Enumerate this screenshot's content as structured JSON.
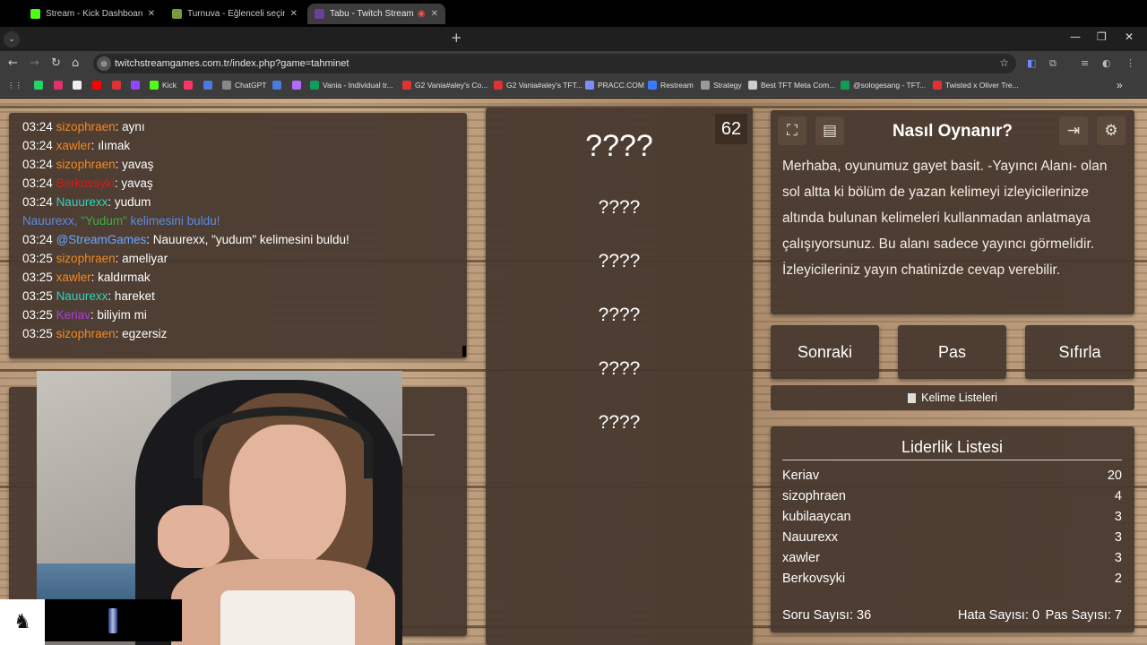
{
  "browser": {
    "tabs": [
      {
        "title": "Stream - Kick Dashboard",
        "close": "✕",
        "favicon_color": "#53fc18"
      },
      {
        "title": "Turnuva - Eğlenceli seçimler yap",
        "close": "✕",
        "favicon_color": "#7a9a3a"
      },
      {
        "title": "Tabu - Twitch Stream Games",
        "close": "✕",
        "favicon_color": "#6b3fa0",
        "recording": "◉"
      }
    ],
    "new_tab": "+",
    "url": "twitchstreamgames.com.tr/index.php?game=tahminet",
    "window_controls": {
      "minimize": "—",
      "maximize": "❐",
      "close": "✕"
    },
    "nav": {
      "back": "←",
      "forward": "→",
      "reload": "↻",
      "home": "⌂",
      "site_info": "⊜",
      "star": "☆",
      "menu": "⋮"
    },
    "bookmarks": [
      {
        "label": "",
        "color": "#25d366"
      },
      {
        "label": "",
        "color": "#e1306c"
      },
      {
        "label": "",
        "color": "#222222"
      },
      {
        "label": "",
        "color": "#ff0000"
      },
      {
        "label": "",
        "color": "#d33"
      },
      {
        "label": "",
        "color": "#9146ff"
      },
      {
        "label": "Kick",
        "color": "#53fc18"
      },
      {
        "label": "",
        "color": "#ff3366"
      },
      {
        "label": "",
        "color": "#4a7adf"
      },
      {
        "label": "ChatGPT",
        "color": "#888888"
      },
      {
        "label": "",
        "color": "#4a7adf"
      },
      {
        "label": "",
        "color": "#b36bff"
      },
      {
        "label": "Vania - Individual tr...",
        "color": "#0f9d58"
      },
      {
        "label": "G2 Vania#aley's Co...",
        "color": "#d33"
      },
      {
        "label": "G2 Vania#aley's TFT...",
        "color": "#d33"
      },
      {
        "label": "PRACC.COM",
        "color": "#7b8cff"
      },
      {
        "label": "Restream",
        "color": "#3b7bff"
      },
      {
        "label": "Strategy",
        "color": "#999999"
      },
      {
        "label": "Best TFT Meta Com...",
        "color": "#cccccc"
      },
      {
        "label": "@sologesang - TFT...",
        "color": "#0f9d58"
      },
      {
        "label": "Twisted x Oliver Tre...",
        "color": "#d33"
      }
    ],
    "bookmarks_more": "»"
  },
  "chat": {
    "messages": [
      {
        "time": "03:24",
        "user": "sizophraen",
        "color": "#f08a24",
        "text": ": aynı"
      },
      {
        "time": "03:24",
        "user": "xawler",
        "color": "#f08a24",
        "text": ": ılımak"
      },
      {
        "time": "03:24",
        "user": "sizophraen",
        "color": "#f08a24",
        "text": ": yavaş"
      },
      {
        "time": "03:24",
        "user": "Berkovsyki",
        "color": "#d41c1c",
        "text": ": yavaş"
      },
      {
        "time": "03:24",
        "user": "Nauurexx",
        "color": "#2fd3c0",
        "text": ": yudum"
      },
      {
        "time": "03:24",
        "user": "@StreamGames",
        "color": "#69a8ff",
        "text": ": Nauurexx, \"yudum\" kelimesini buldu!"
      },
      {
        "time": "03:25",
        "user": "sizophraen",
        "color": "#f08a24",
        "text": ": ameliyar"
      },
      {
        "time": "03:25",
        "user": "xawler",
        "color": "#f08a24",
        "text": ": kaldırmak"
      },
      {
        "time": "03:25",
        "user": "Nauurexx",
        "color": "#2fd3c0",
        "text": ": hareket"
      },
      {
        "time": "03:25",
        "user": "Keriav",
        "color": "#b03ae0",
        "text": ": biliyim mi"
      },
      {
        "time": "03:25",
        "user": "sizophraen",
        "color": "#f08a24",
        "text": ": egzersiz"
      }
    ],
    "system_notice": {
      "prefix": "Nauurexx, ",
      "word": "\"Yudum\"",
      "suffix": " kelimesini buldu!"
    }
  },
  "game": {
    "timer": "62",
    "main_word": "????",
    "forbidden_words": [
      "????",
      "????",
      "????",
      "????",
      "????"
    ]
  },
  "howto": {
    "title": "Nasıl Oynanır?",
    "text": "Merhaba, oyunumuz gayet basit. -Yayıncı Alanı- olan sol altta ki bölüm de yazan kelimeyi izleyicilerinize altında bulunan kelimeleri kullanmadan anlatmaya çalışıyorsunuz. Bu alanı sadece yayıncı görmelidir. İzleyicileriniz yayın chatinizde cevap verebilir.",
    "icons": {
      "fullscreen": "⛶",
      "notes": "▤",
      "exit": "⇥",
      "settings": "⚙"
    }
  },
  "controls": {
    "next": "Sonraki",
    "pass": "Pas",
    "reset": "Sıfırla",
    "word_lists": "Kelime Listeleri"
  },
  "leaderboard": {
    "title": "Liderlik Listesi",
    "rows": [
      {
        "name": "Keriav",
        "score": "20"
      },
      {
        "name": "sizophraen",
        "score": "4"
      },
      {
        "name": "kubilaaycan",
        "score": "3"
      },
      {
        "name": "Nauurexx",
        "score": "3"
      },
      {
        "name": "xawler",
        "score": "3"
      },
      {
        "name": "Berkovsyki",
        "score": "2"
      }
    ],
    "stats": {
      "questions": "Soru Sayısı: 36",
      "errors": "Hata Sayısı: 0",
      "passes": "Pas Sayısı: 7"
    }
  },
  "overlay": {
    "logo": "♞"
  }
}
